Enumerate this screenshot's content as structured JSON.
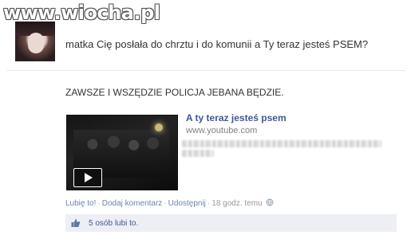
{
  "watermark": "www.wiocha.pl",
  "top_comment": {
    "text": "matka Cię posłała do chrztu i do komunii a Ty teraz jesteś PSEM?"
  },
  "post": {
    "text": "ZAWSZE I WSZĘDZIE POLICJA JEBANA BĘDZIE.",
    "share": {
      "title": "A ty teraz jesteś psem",
      "domain": "www.youtube.com"
    },
    "actions": {
      "like": "Lubię to!",
      "comment": "Dodaj komentarz",
      "share": "Udostępnij",
      "separator": "·",
      "time": "18 godz. temu"
    },
    "likes": {
      "count": "5 osób",
      "suffix": "lubi to."
    }
  },
  "colors": {
    "link": "#3b5998",
    "meta_link": "#6d84b4",
    "likes_bg": "#edeff4"
  }
}
